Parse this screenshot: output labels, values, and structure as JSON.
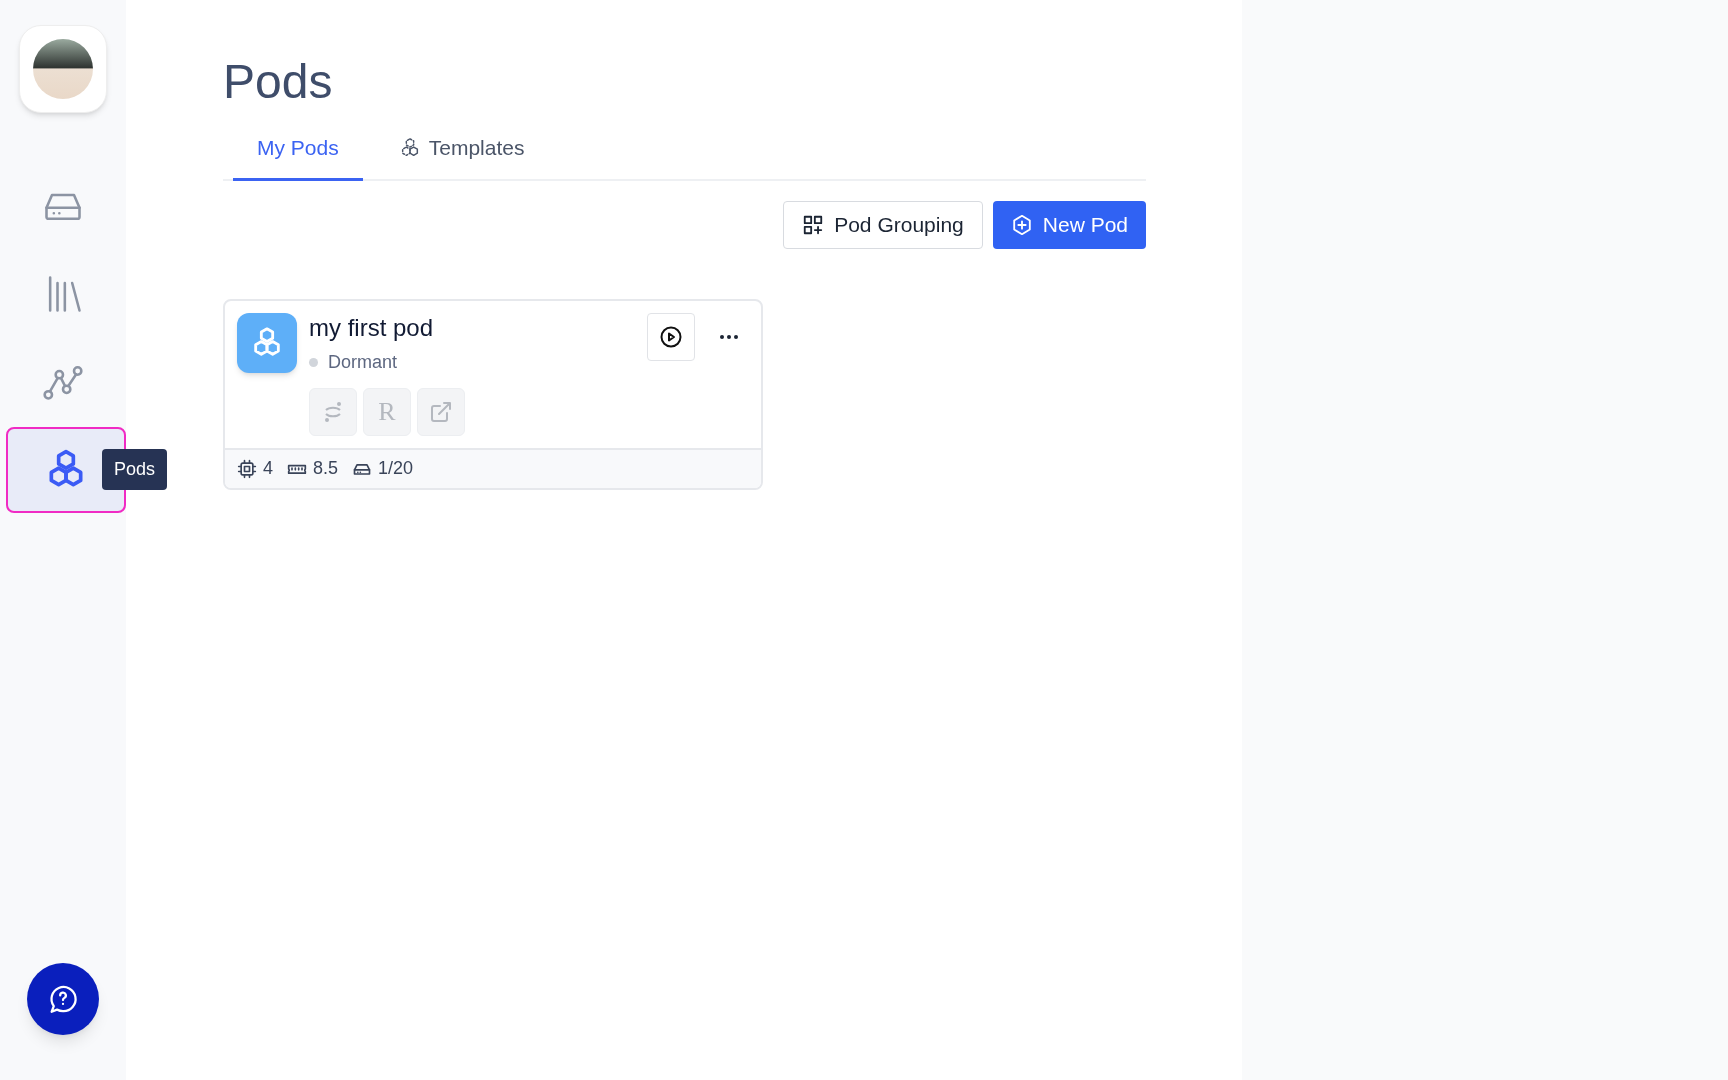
{
  "sidebar": {
    "items": [
      {
        "kind": "drive",
        "selected": false
      },
      {
        "kind": "library",
        "selected": false
      },
      {
        "kind": "graph",
        "selected": false
      },
      {
        "kind": "pods",
        "selected": true,
        "tooltip": "Pods"
      }
    ]
  },
  "page": {
    "title": "Pods"
  },
  "tabs": [
    {
      "label": "My Pods",
      "selected": true,
      "kind": "plain"
    },
    {
      "label": "Templates",
      "selected": false,
      "kind": "templates"
    }
  ],
  "toolbar": {
    "buttons": [
      {
        "label": "Pod Grouping",
        "kind": "secondary"
      },
      {
        "label": "New Pod",
        "kind": "primary"
      }
    ]
  },
  "pods": [
    {
      "name": "my first pod",
      "status": "Dormant",
      "color": "#d1d5db",
      "tools": [
        {
          "kind": "jupyter"
        },
        {
          "kind": "text",
          "label": "R"
        },
        {
          "kind": "external"
        }
      ],
      "specs": [
        {
          "kind": "cpu",
          "value": "4"
        },
        {
          "kind": "memory",
          "value": "8.5"
        },
        {
          "kind": "storage",
          "value": "1/20"
        }
      ]
    }
  ]
}
